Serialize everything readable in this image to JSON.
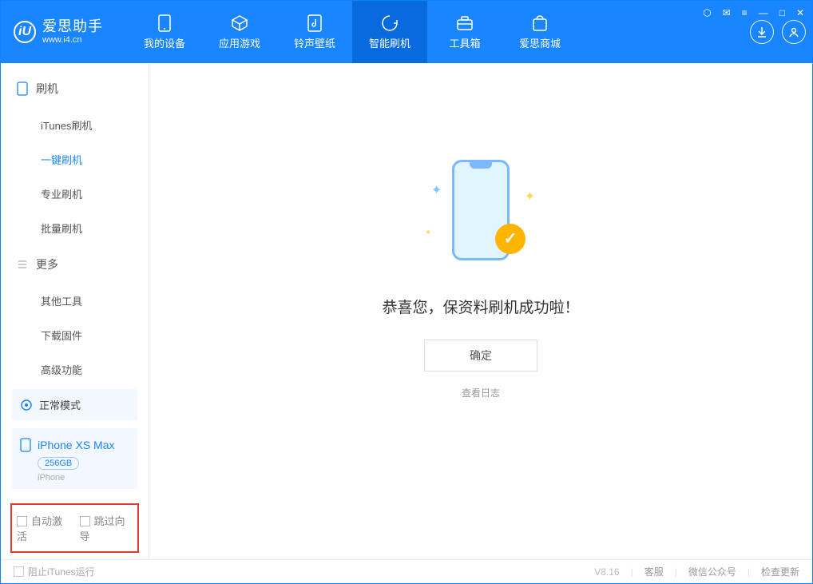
{
  "app": {
    "title": "爱思助手",
    "subtitle": "www.i4.cn",
    "logo_glyph": "iU"
  },
  "nav": {
    "items": [
      {
        "label": "我的设备"
      },
      {
        "label": "应用游戏"
      },
      {
        "label": "铃声壁纸"
      },
      {
        "label": "智能刷机"
      },
      {
        "label": "工具箱"
      },
      {
        "label": "爱思商城"
      }
    ],
    "active_index": 3
  },
  "win": {
    "skin": "⬡",
    "feedback": "✉",
    "menu": "≡",
    "min": "—",
    "max": "□",
    "close": "✕"
  },
  "sidebar": {
    "group1": {
      "title": "刷机",
      "items": [
        {
          "label": "iTunes刷机"
        },
        {
          "label": "一键刷机"
        },
        {
          "label": "专业刷机"
        },
        {
          "label": "批量刷机"
        }
      ],
      "active_index": 1
    },
    "group2": {
      "title": "更多",
      "items": [
        {
          "label": "其他工具"
        },
        {
          "label": "下载固件"
        },
        {
          "label": "高级功能"
        }
      ]
    },
    "mode": {
      "label": "正常模式"
    },
    "device": {
      "name": "iPhone XS Max",
      "capacity": "256GB",
      "type": "iPhone"
    },
    "options": {
      "auto_activate": "自动激活",
      "skip_guide": "跳过向导"
    }
  },
  "main": {
    "success": "恭喜您，保资料刷机成功啦！",
    "ok": "确定",
    "view_log": "查看日志"
  },
  "footer": {
    "block_itunes": "阻止iTunes运行",
    "version": "V8.16",
    "support": "客服",
    "wechat": "微信公众号",
    "update": "检查更新"
  }
}
